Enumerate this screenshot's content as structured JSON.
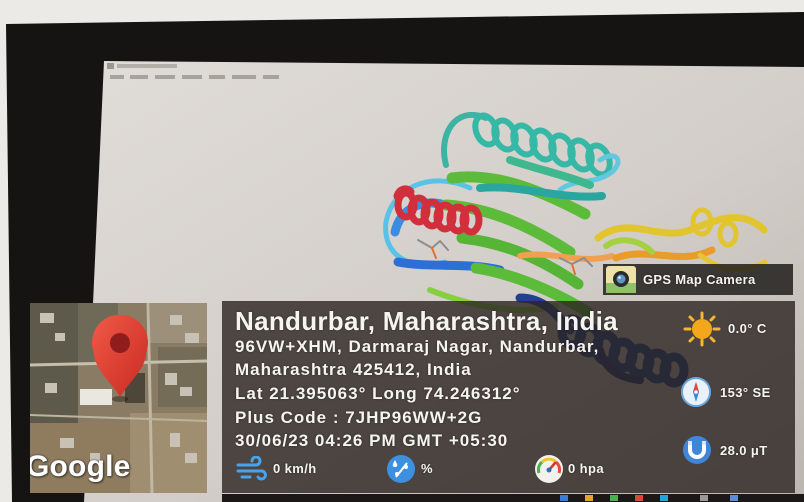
{
  "gps_badge": {
    "label": "GPS Map Camera",
    "icon": "gps-map-camera-logo-icon"
  },
  "location": {
    "title": "Nandurbar, Maharashtra, India",
    "address_line1": "96VW+XHM, Darmaraj Nagar, Nandurbar,",
    "address_line2": "Maharashtra 425412, India",
    "coordinates": "Lat 21.395063° Long 74.246312°",
    "plus_code": "Plus Code : 7JHP96WW+2G",
    "datetime": "30/06/23 04:26 PM GMT +05:30"
  },
  "weather": {
    "wind": {
      "value": "0 km/h",
      "icon": "wind-icon"
    },
    "humidity": {
      "value": "%",
      "icon": "humidity-icon"
    },
    "pressure": {
      "value": "0 hpa",
      "icon": "pressure-gauge-icon"
    },
    "temperature": {
      "value": "0.0° C",
      "icon": "sun-icon"
    },
    "direction": {
      "value": "153° SE",
      "icon": "compass-icon"
    },
    "magnetic_field": {
      "value": "28.0 μT",
      "icon": "magnet-icon"
    }
  },
  "map_thumbnail": {
    "brand": "Google",
    "marker_icon": "map-pin-icon"
  },
  "viewer": {
    "structure_icon": "protein-ribbon-icon"
  },
  "colors": {
    "overlay_bg": "#2a2321",
    "overlay_text": "#ffffff",
    "map_pin": "#e33b2e",
    "screen_bg": "#d6d1cc",
    "bezel": "#161413"
  }
}
